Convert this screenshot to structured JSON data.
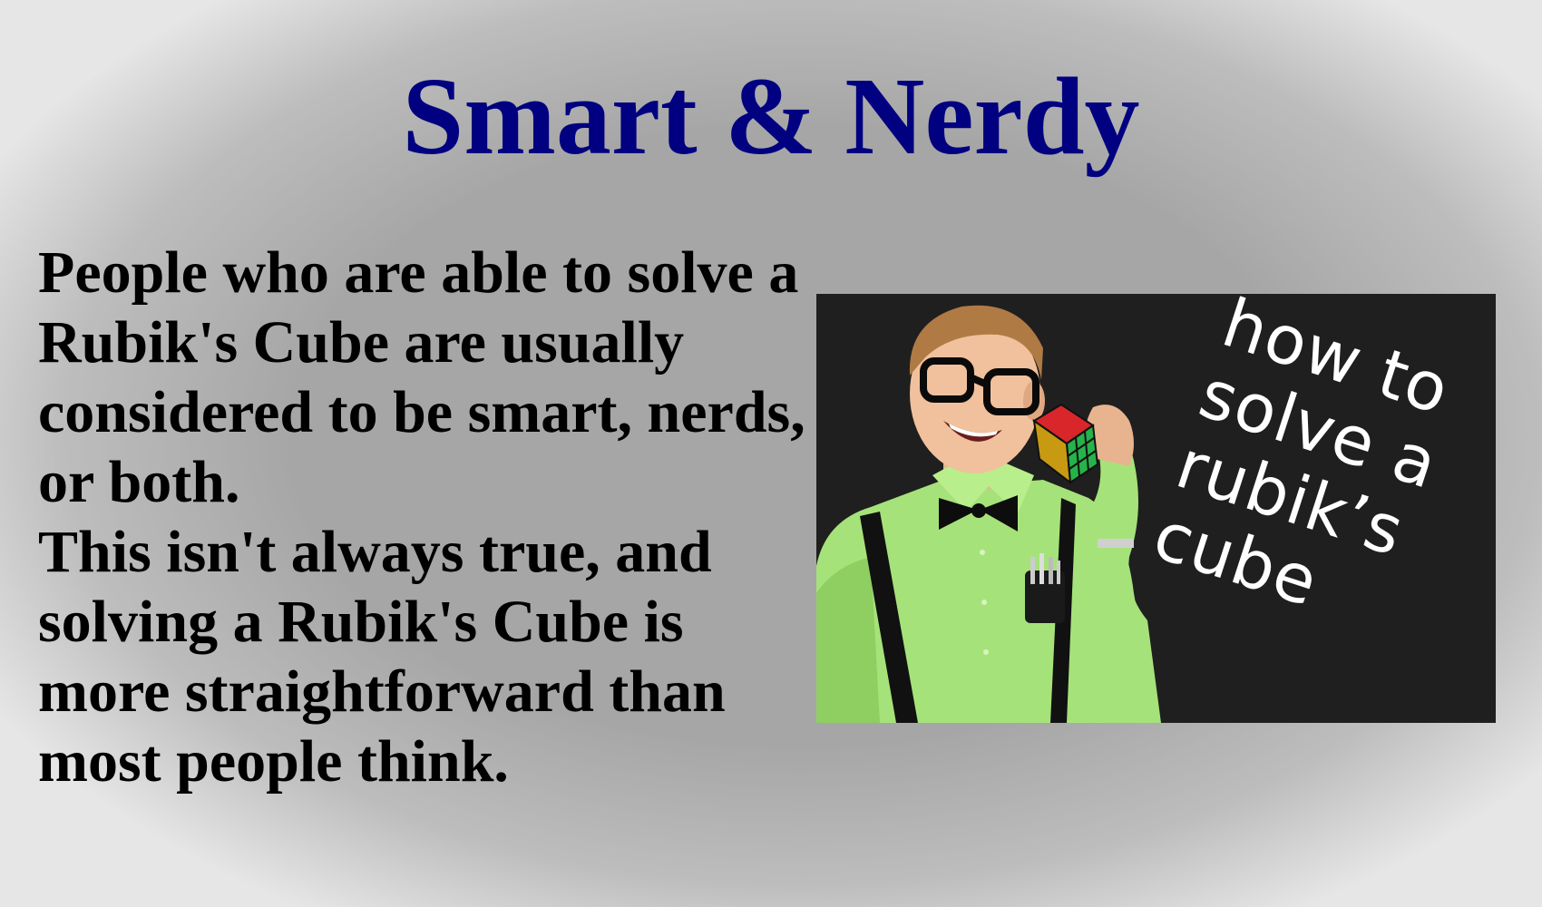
{
  "slide": {
    "title": "Smart & Nerdy",
    "paragraph_1": "People who are able to solve a Rubik's Cube are usually considered to be smart, nerds, or both.",
    "paragraph_2": "This isn't always true, and solving a Rubik's Cube is more straightforward than most people think."
  },
  "image": {
    "subject": "nerd-with-rubiks-cube-photo",
    "overlay_lines": [
      "how to",
      "solve a",
      "rubik’s",
      "cube"
    ]
  },
  "colors": {
    "title": "#000080",
    "body_text": "#000000",
    "photo_background": "#1f1f1f",
    "shirt": "#a6e27a",
    "overlay_text": "#ffffff"
  }
}
